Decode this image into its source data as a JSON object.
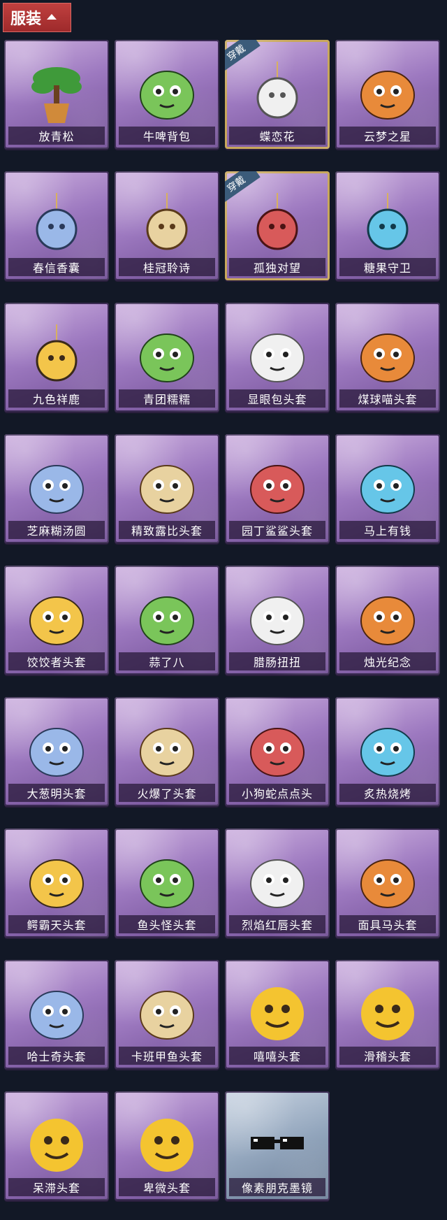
{
  "header": {
    "category_label": "服装",
    "toggle_icon": "chevron-up-icon"
  },
  "badge_worn": "穿戴",
  "items": [
    {
      "name": "放青松",
      "icon": "bonsai-tree-icon",
      "worn": false,
      "variant": "purple"
    },
    {
      "name": "牛啤背包",
      "icon": "cow-beer-barrel-icon",
      "worn": false,
      "variant": "purple"
    },
    {
      "name": "蝶恋花",
      "icon": "butterfly-bell-ornament-icon",
      "worn": true,
      "variant": "purple"
    },
    {
      "name": "云梦之星",
      "icon": "unicorn-cloud-icon",
      "worn": false,
      "variant": "purple"
    },
    {
      "name": "春信香囊",
      "icon": "sachet-icon",
      "worn": false,
      "variant": "purple"
    },
    {
      "name": "桂冠聆诗",
      "icon": "laurel-doll-charm-icon",
      "worn": false,
      "variant": "purple"
    },
    {
      "name": "孤独对望",
      "icon": "crystal-doll-charm-icon",
      "worn": true,
      "variant": "purple"
    },
    {
      "name": "糖果守卫",
      "icon": "pumpkin-charm-icon",
      "worn": false,
      "variant": "purple"
    },
    {
      "name": "九色祥鹿",
      "icon": "deer-charm-icon",
      "worn": false,
      "variant": "purple"
    },
    {
      "name": "青团糯糯",
      "icon": "green-rice-ball-icon",
      "worn": false,
      "variant": "purple"
    },
    {
      "name": "显眼包头套",
      "icon": "lightbulb-head-icon",
      "worn": false,
      "variant": "purple"
    },
    {
      "name": "煤球喵头套",
      "icon": "black-cat-head-icon",
      "worn": false,
      "variant": "purple"
    },
    {
      "name": "芝麻糊汤圆",
      "icon": "dumpling-head-icon",
      "worn": false,
      "variant": "purple"
    },
    {
      "name": "精致露比头套",
      "icon": "pink-beaver-head-icon",
      "worn": false,
      "variant": "purple"
    },
    {
      "name": "园丁鲨鲨头套",
      "icon": "shark-head-icon",
      "worn": false,
      "variant": "purple"
    },
    {
      "name": "马上有钱",
      "icon": "red-horse-head-icon",
      "worn": false,
      "variant": "purple"
    },
    {
      "name": "饺饺者头套",
      "icon": "cloud-dumpling-head-icon",
      "worn": false,
      "variant": "purple"
    },
    {
      "name": "蒜了八",
      "icon": "garlic-head-icon",
      "worn": false,
      "variant": "purple"
    },
    {
      "name": "腊肠扭扭",
      "icon": "dachshund-head-icon",
      "worn": false,
      "variant": "purple"
    },
    {
      "name": "烛光纪念",
      "icon": "candle-head-icon",
      "worn": false,
      "variant": "purple"
    },
    {
      "name": "大葱明头套",
      "icon": "scallion-head-icon",
      "worn": false,
      "variant": "purple"
    },
    {
      "name": "火爆了头套",
      "icon": "fire-head-icon",
      "worn": false,
      "variant": "purple"
    },
    {
      "name": "小狗蛇点点头",
      "icon": "dog-snake-head-icon",
      "worn": false,
      "variant": "purple"
    },
    {
      "name": "炙热烧烤",
      "icon": "bbq-meat-head-icon",
      "worn": false,
      "variant": "purple"
    },
    {
      "name": "鳄霸天头套",
      "icon": "crocodile-head-icon",
      "worn": false,
      "variant": "purple"
    },
    {
      "name": "鱼头怪头套",
      "icon": "fish-head-icon",
      "worn": false,
      "variant": "purple"
    },
    {
      "name": "烈焰红唇头套",
      "icon": "yellow-mouse-head-icon",
      "worn": false,
      "variant": "purple"
    },
    {
      "name": "面具马头套",
      "icon": "horse-mask-head-icon",
      "worn": false,
      "variant": "purple"
    },
    {
      "name": "哈士奇头套",
      "icon": "husky-head-icon",
      "worn": false,
      "variant": "purple"
    },
    {
      "name": "卡班甲鱼头套",
      "icon": "turtle-head-icon",
      "worn": false,
      "variant": "purple"
    },
    {
      "name": "嘻嘻头套",
      "icon": "grin-emoji-head-icon",
      "worn": false,
      "variant": "purple"
    },
    {
      "name": "滑稽头套",
      "icon": "smirk-emoji-head-icon",
      "worn": false,
      "variant": "purple"
    },
    {
      "name": "呆滞头套",
      "icon": "stare-emoji-head-icon",
      "worn": false,
      "variant": "purple"
    },
    {
      "name": "卑微头套",
      "icon": "humble-emoji-head-icon",
      "worn": false,
      "variant": "purple"
    },
    {
      "name": "像素朋克墨镜",
      "icon": "pixel-sunglasses-icon",
      "worn": false,
      "variant": "special"
    }
  ],
  "colors": {
    "background": "#121826",
    "card_purple": "#9d79c0",
    "card_special": "#93a6bd",
    "header_red": "#b23533",
    "worn_border": "#c8a75a"
  }
}
